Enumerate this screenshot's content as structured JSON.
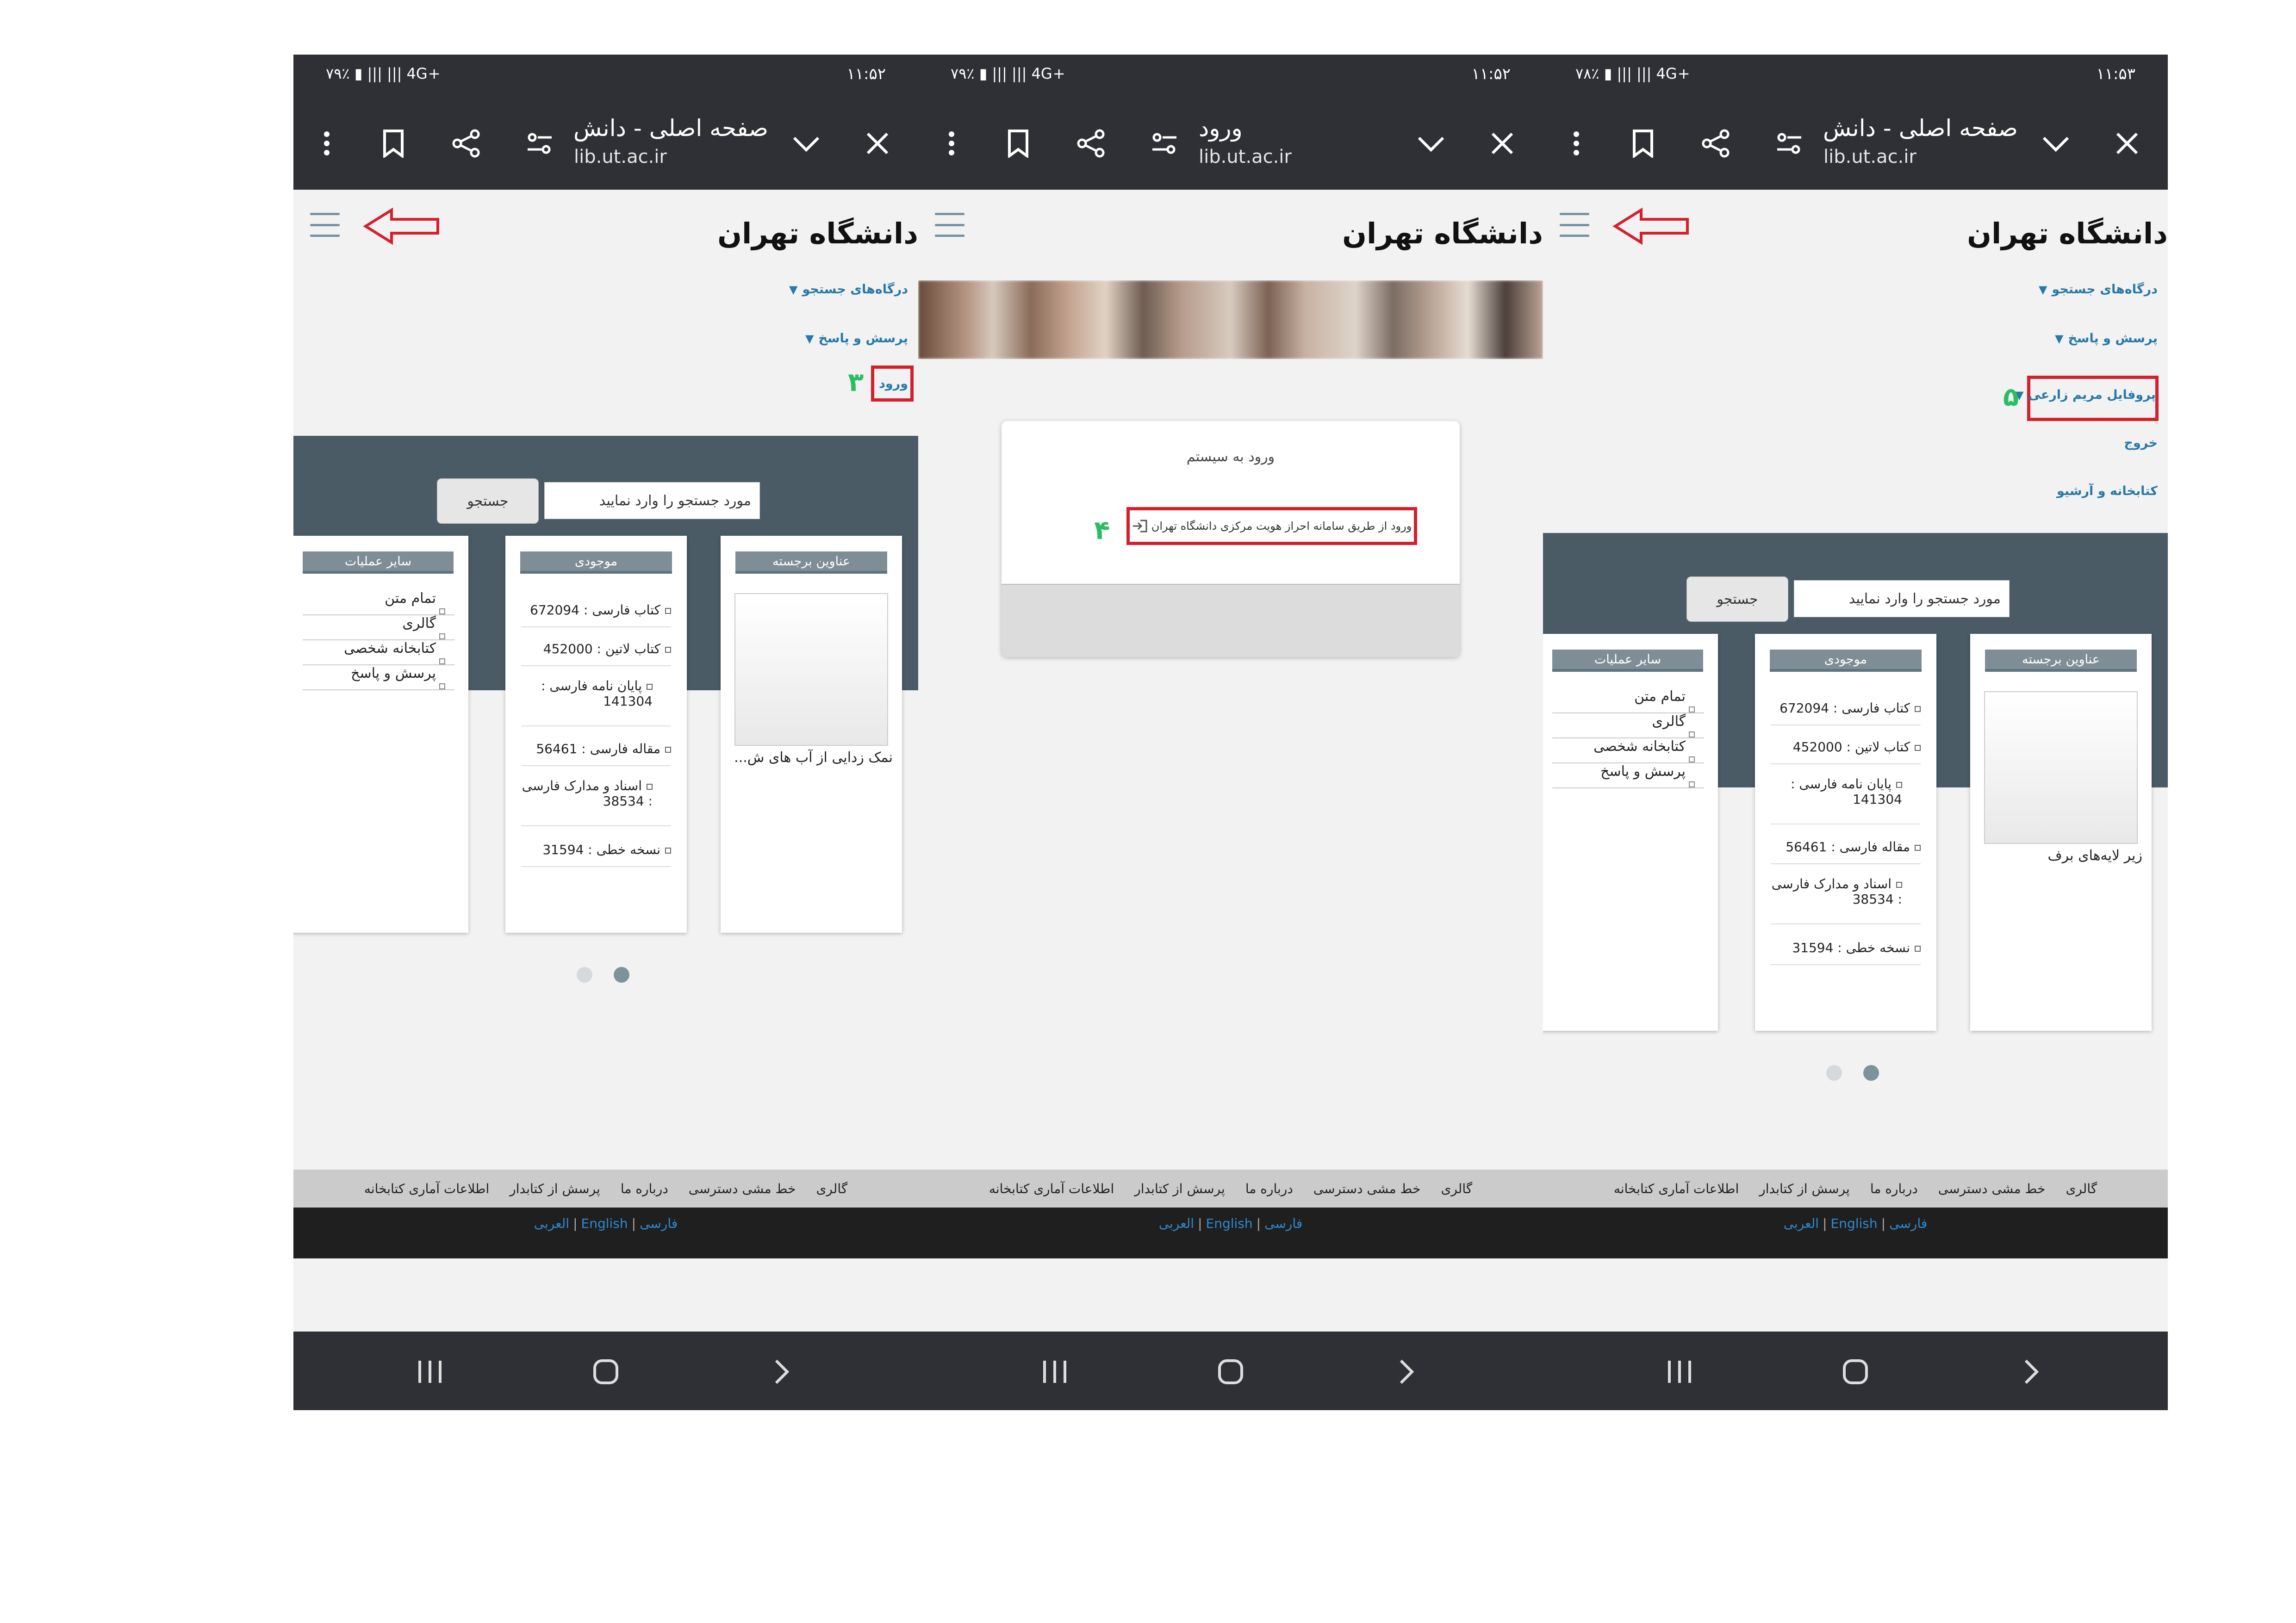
{
  "panels": [
    {
      "status": {
        "time": "۱۱:۵۲",
        "icons": "۷۹٪ ▮ ||| ||| 4G+"
      },
      "browser": {
        "title": "صفحه اصلی - دانش...",
        "url": "lib.ut.ac.ir"
      },
      "site": {
        "logo": "دانشگاه تهران",
        "menu": [
          "درگاه‌های جستجو",
          "پرسش و پاسخ"
        ],
        "login_link": "ورود",
        "step": "۳",
        "search_placeholder": "مورد جستجو را وارد نمایید",
        "search_button": "جستجو",
        "featured_title": "عناوین برجسته",
        "featured_caption": "نمک زدایی از آب های ش... ",
        "stock_title": "موجودی",
        "stock": [
          "کتاب فارسی : 672094",
          "کتاب لاتین : 452000",
          "پایان نامه فارسی : 141304",
          "مقاله فارسی : 56461",
          "اسناد و مدارک فارسی : 38534",
          "نسخه خطی : 31594"
        ],
        "ops_title": "سایر عملیات",
        "ops": [
          "تمام متن",
          "گالری",
          "کتابخانه شخصی",
          "پرسش و پاسخ"
        ]
      }
    },
    {
      "status": {
        "time": "۱۱:۵۲",
        "icons": "۷۹٪ ▮ ||| ||| 4G+"
      },
      "browser": {
        "title": "ورود",
        "url": "lib.ut.ac.ir"
      },
      "site": {
        "logo": "دانشگاه تهران",
        "login_title": "ورود به سیستم",
        "login_sso": "ورود از طریق سامانه احراز هویت مرکزی دانشگاه تهران",
        "step": "۴"
      }
    },
    {
      "status": {
        "time": "۱۱:۵۳",
        "icons": "۷۸٪ ▮ ||| ||| 4G+"
      },
      "browser": {
        "title": "صفحه اصلی - دانش...",
        "url": "lib.ut.ac.ir"
      },
      "site": {
        "logo": "دانشگاه تهران",
        "menu": [
          "درگاه‌های جستجو",
          "پرسش و پاسخ"
        ],
        "profile_link": "پروفایل مریم زارعی",
        "step": "۵",
        "menu_extra": [
          "خروج",
          "کتابخانه و آرشیو"
        ],
        "search_placeholder": "مورد جستجو را وارد نمایید",
        "search_button": "جستجو",
        "featured_title": "عناوین برجسته",
        "featured_caption": "زیر لایه‌های برف",
        "stock_title": "موجودی",
        "stock": [
          "کتاب فارسی : 672094",
          "کتاب لاتین : 452000",
          "پایان نامه فارسی : 141304",
          "مقاله فارسی : 56461",
          "اسناد و مدارک فارسی : 38534",
          "نسخه خطی : 31594"
        ],
        "ops_title": "سایر عملیات",
        "ops": [
          "تمام متن",
          "گالری",
          "کتابخانه شخصی",
          "پرسش و پاسخ"
        ]
      }
    }
  ],
  "footer": {
    "links": [
      "گالری",
      "خط مشی دسترسی",
      "درباره ما",
      "پرسش از کتابدار",
      "اطلاعات آماری کتابخانه"
    ],
    "languages": [
      "فارسی",
      "English",
      "العربی"
    ]
  },
  "colors": {
    "annotation_red": "#d41f2c",
    "step_green": "#2bbd64",
    "link_blue": "#2779a7",
    "hero": "#4a5b66",
    "chrome": "#2f3035"
  },
  "icons": [
    "battery-icon",
    "signal-icon",
    "menu-dots-icon",
    "bookmark-icon",
    "share-icon",
    "filter-icon",
    "chevron-down-icon",
    "close-icon",
    "hamburger-icon",
    "red-arrow-icon",
    "login-icon",
    "recents-icon",
    "home-icon",
    "back-icon"
  ]
}
